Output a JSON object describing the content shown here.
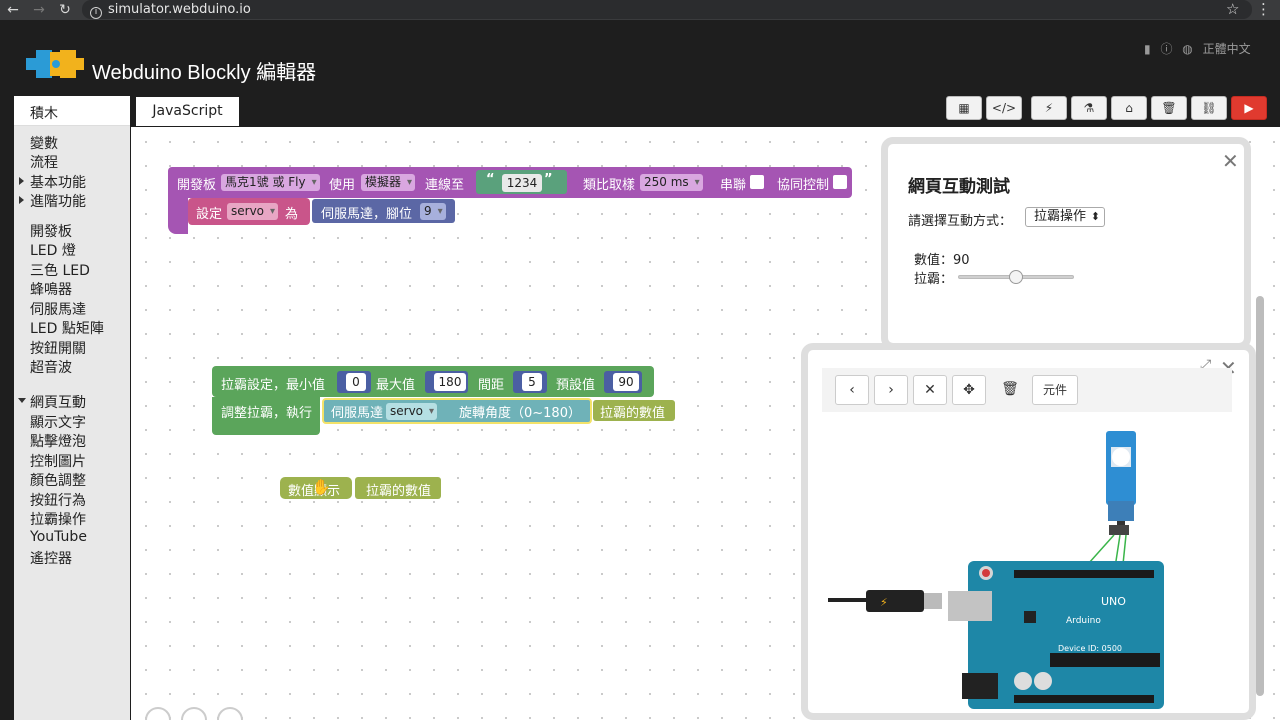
{
  "browser": {
    "url": "simulator.webduino.io",
    "back_icon": "back-arrow-icon",
    "forward_icon": "forward-arrow-icon",
    "reload_icon": "reload-icon"
  },
  "header": {
    "title": "Webduino Blockly 編輯器",
    "language": "正體中文"
  },
  "sidebar": {
    "title": "積木",
    "categories": [
      "變數",
      "流程",
      "基本功能",
      "進階功能",
      "開發板",
      "LED 燈",
      "三色 LED",
      "蜂鳴器",
      "伺服馬達",
      "LED 點矩陣",
      "按鈕開關",
      "超音波",
      "網頁互動",
      "顯示文字",
      "點擊燈泡",
      "控制圖片",
      "顏色調整",
      "按鈕行為",
      "拉霸操作",
      "YouTube",
      "遙控器"
    ]
  },
  "tabs": {
    "js": "JavaScript"
  },
  "blocks": {
    "board": {
      "open_board": "開發板",
      "board_type": "馬克1號 或 Fly",
      "use": "使用",
      "device": "模擬器",
      "connect_to": "連線至",
      "device_id": "1234",
      "sampling": "類比取樣",
      "interval": "250 ms",
      "serial": "串聯",
      "coop": "協同控制",
      "set": "設定",
      "var_name": "servo",
      "as": "為",
      "servo_pin": "伺服馬達，腳位",
      "pin": "9"
    },
    "slider": {
      "setting": "拉霸設定，最小值",
      "min": "0",
      "max_label": "最大值",
      "max": "180",
      "step_label": "間距",
      "step": "5",
      "default_label": "預設值",
      "default": "90",
      "adjust": "調整拉霸，執行",
      "servo": "伺服馬達",
      "servo_var": "servo",
      "rotate": "旋轉角度（0~180）",
      "value": "拉霸的數值"
    },
    "display": {
      "show": "數值顯示",
      "value": "拉霸的數值"
    }
  },
  "panel_interact": {
    "title": "網頁互動測試",
    "prompt": "請選擇互動方式：",
    "mode": "拉霸操作",
    "value_row": "數值：90",
    "slider_label": "拉霸：",
    "slider_value": 90,
    "slider_max": 180
  },
  "panel_sim": {
    "component_label": "元件"
  },
  "board_labels": {
    "arduino": "Arduino",
    "uno": "UNO",
    "device_id": "Device ID: 0500"
  }
}
